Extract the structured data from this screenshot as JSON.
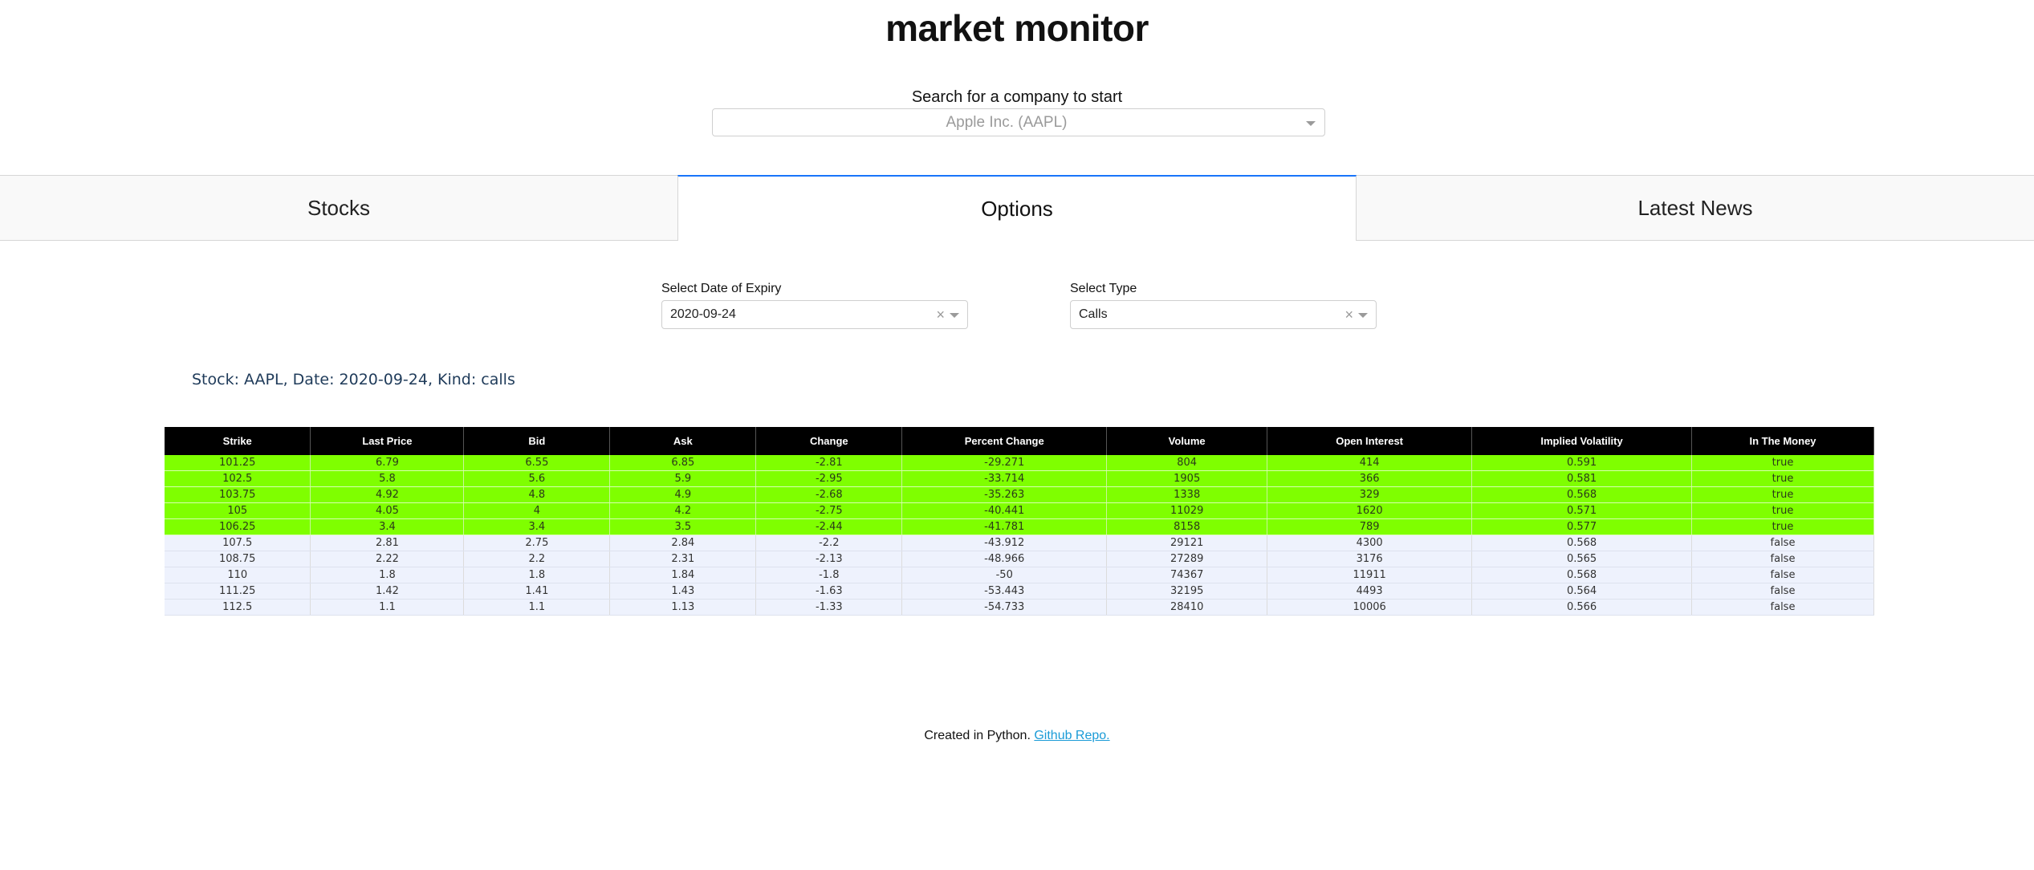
{
  "header": {
    "title": "market monitor",
    "search_label": "Search for a company to start",
    "company_value": "Apple Inc. (AAPL)"
  },
  "tabs": [
    {
      "label": "Stocks",
      "active": false
    },
    {
      "label": "Options",
      "active": true
    },
    {
      "label": "Latest News",
      "active": false
    }
  ],
  "filters": {
    "expiry": {
      "label": "Select Date of Expiry",
      "value": "2020-09-24"
    },
    "type": {
      "label": "Select Type",
      "value": "Calls"
    }
  },
  "caption": "Stock: AAPL, Date: 2020-09-24, Kind: calls",
  "table": {
    "columns": [
      "Strike",
      "Last Price",
      "Bid",
      "Ask",
      "Change",
      "Percent Change",
      "Volume",
      "Open Interest",
      "Implied Volatility",
      "In The Money"
    ],
    "rows": [
      [
        "101.25",
        "6.79",
        "6.55",
        "6.85",
        "-2.81",
        "-29.271",
        "804",
        "414",
        "0.591",
        "true"
      ],
      [
        "102.5",
        "5.8",
        "5.6",
        "5.9",
        "-2.95",
        "-33.714",
        "1905",
        "366",
        "0.581",
        "true"
      ],
      [
        "103.75",
        "4.92",
        "4.8",
        "4.9",
        "-2.68",
        "-35.263",
        "1338",
        "329",
        "0.568",
        "true"
      ],
      [
        "105",
        "4.05",
        "4",
        "4.2",
        "-2.75",
        "-40.441",
        "11029",
        "1620",
        "0.571",
        "true"
      ],
      [
        "106.25",
        "3.4",
        "3.4",
        "3.5",
        "-2.44",
        "-41.781",
        "8158",
        "789",
        "0.577",
        "true"
      ],
      [
        "107.5",
        "2.81",
        "2.75",
        "2.84",
        "-2.2",
        "-43.912",
        "29121",
        "4300",
        "0.568",
        "false"
      ],
      [
        "108.75",
        "2.22",
        "2.2",
        "2.31",
        "-2.13",
        "-48.966",
        "27289",
        "3176",
        "0.565",
        "false"
      ],
      [
        "110",
        "1.8",
        "1.8",
        "1.84",
        "-1.8",
        "-50",
        "74367",
        "11911",
        "0.568",
        "false"
      ],
      [
        "111.25",
        "1.42",
        "1.41",
        "1.43",
        "-1.63",
        "-53.443",
        "32195",
        "4493",
        "0.564",
        "false"
      ],
      [
        "112.5",
        "1.1",
        "1.1",
        "1.13",
        "-1.33",
        "-54.733",
        "28410",
        "10006",
        "0.566",
        "false"
      ]
    ],
    "in_the_money_color": "#7fff00",
    "out_of_money_color": "#eef2fd"
  },
  "footer": {
    "text": "Created in Python.",
    "link_text": "Github Repo."
  },
  "colors": {
    "active_tab_accent": "#1975fa",
    "link": "#1a9bd7"
  },
  "icons": {
    "dropdown_caret": "chevron-down-icon",
    "clear": "close-icon"
  }
}
